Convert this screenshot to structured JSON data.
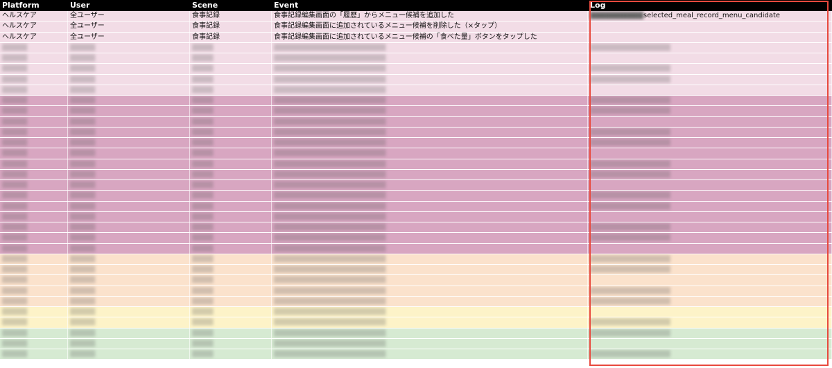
{
  "header": {
    "platform": "Platform",
    "user": "User",
    "scene": "Scene",
    "event": "Event",
    "log": "Log"
  },
  "colors": {
    "header_bg": "#000000",
    "highlight_border": "#e8493d",
    "band_light_pink": "#f2dce6",
    "band_mauve": "#d8a6c1",
    "band_peach": "#fbe2cc",
    "band_yellow": "#fdf3c8",
    "band_green": "#d6ead2"
  },
  "rows": [
    {
      "platform": "ヘルスケア",
      "user": "全ユーザー",
      "scene": "食事記録",
      "event": "食事記録編集画面の「履歴」からメニュー候補を追加した",
      "log": "selected_meal_record_menu_candidate",
      "band": "band_light_pink"
    },
    {
      "platform": "ヘルスケア",
      "user": "全ユーザー",
      "scene": "食事記録",
      "event": "食事記録編集画面に追加されているメニュー候補を削除した（×タップ）",
      "log": "",
      "band": "band_light_pink"
    },
    {
      "platform": "ヘルスケア",
      "user": "全ユーザー",
      "scene": "食事記録",
      "event": "食事記録編集画面に追加されているメニュー候補の「食べた量」ボタンをタップした",
      "log": "",
      "band": "band_light_pink"
    }
  ]
}
